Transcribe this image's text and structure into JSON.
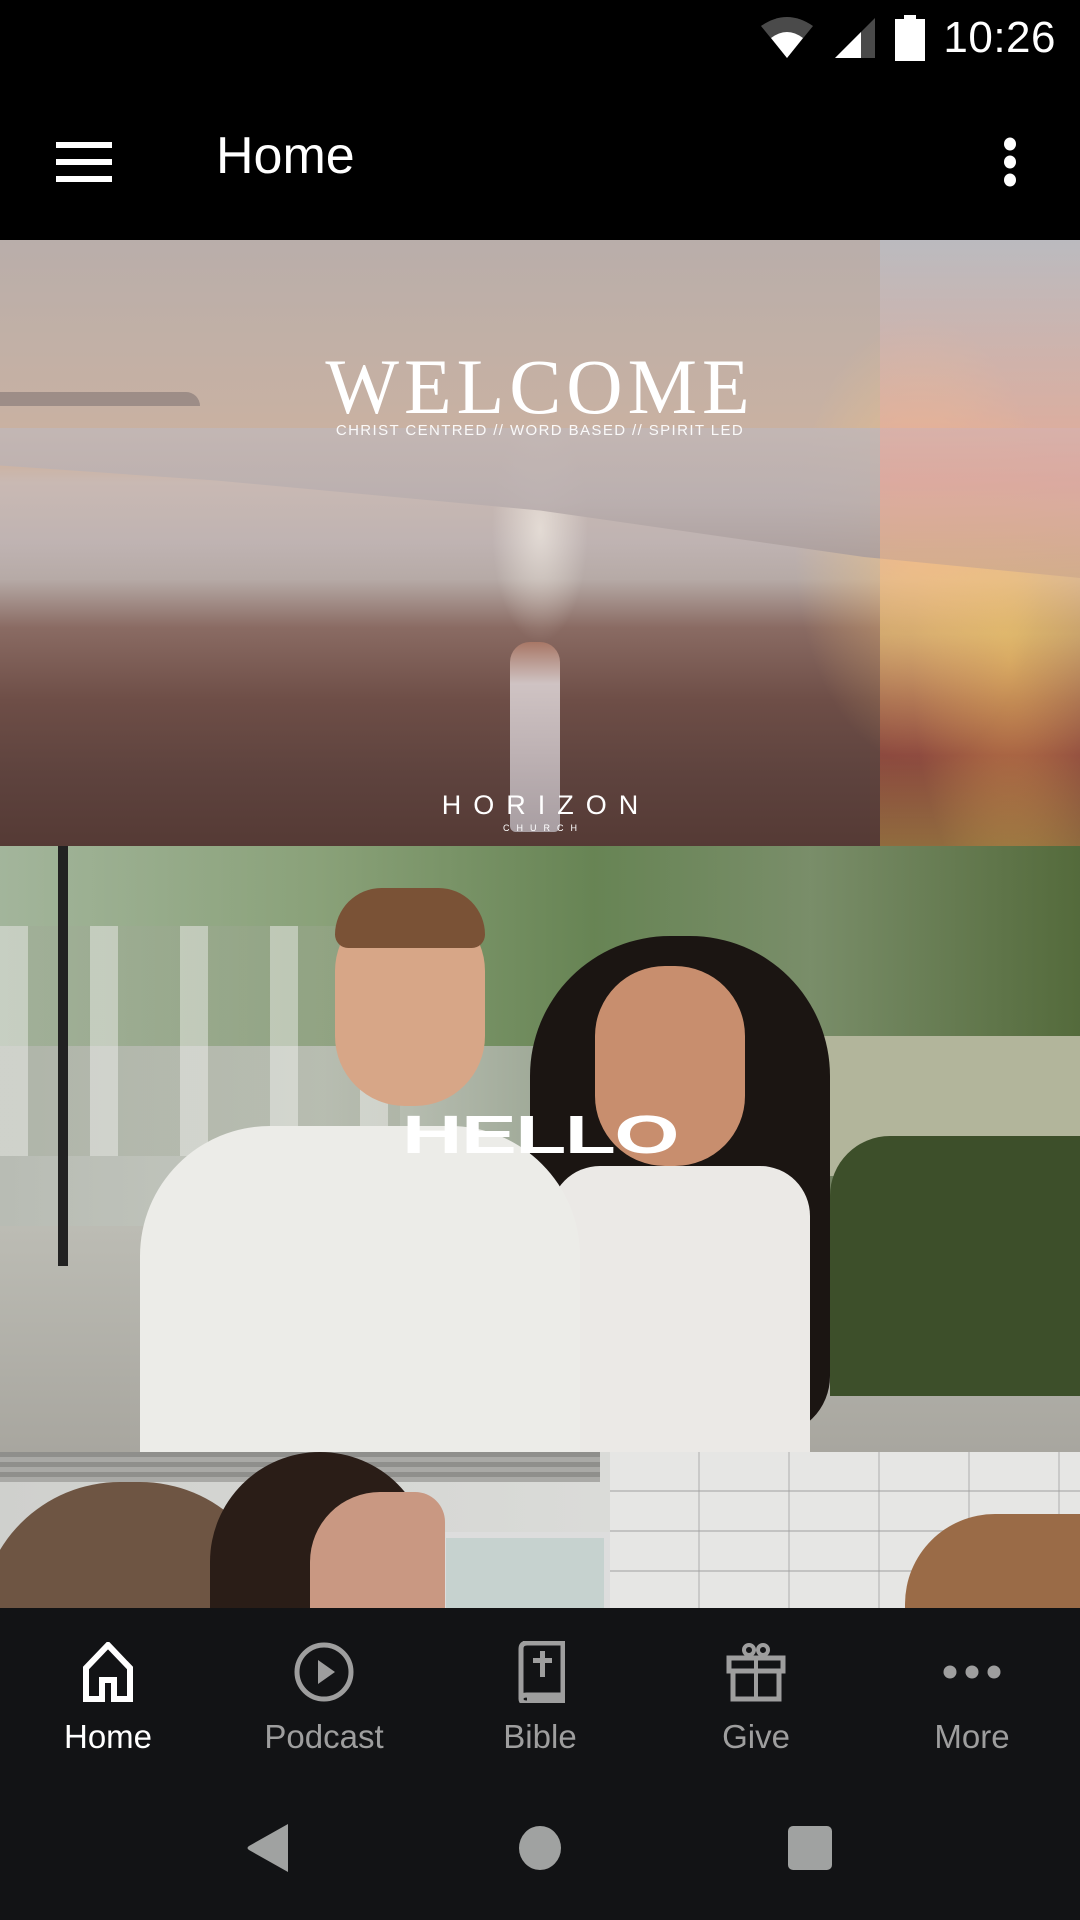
{
  "status_bar": {
    "time": "10:26",
    "icons": [
      "wifi-icon",
      "cellular-signal-icon",
      "battery-icon"
    ]
  },
  "app_bar": {
    "title": "Home",
    "left_icon": "hamburger-menu-icon",
    "right_icon": "overflow-menu-icon"
  },
  "feed": {
    "cards": [
      {
        "title": "WELCOME",
        "subtitle": "CHRIST CENTRED // WORD BASED // SPIRIT LED",
        "brand": "HORIZON",
        "brand_sub": "CHURCH"
      },
      {
        "title": "HELLO"
      },
      {
        "title": ""
      }
    ]
  },
  "bottom_nav": {
    "active_index": 0,
    "items": [
      {
        "label": "Home",
        "icon": "home-icon"
      },
      {
        "label": "Podcast",
        "icon": "play-circle-icon"
      },
      {
        "label": "Bible",
        "icon": "bible-icon"
      },
      {
        "label": "Give",
        "icon": "gift-icon"
      },
      {
        "label": "More",
        "icon": "more-horizontal-icon"
      }
    ]
  },
  "system_nav": {
    "buttons": [
      "back",
      "home",
      "recents"
    ]
  },
  "colors": {
    "app_bar_bg": "#000000",
    "nav_bg": "#121315",
    "nav_active": "#ffffff",
    "nav_inactive": "#9e9e9e",
    "system_button": "#a0a2a1"
  }
}
